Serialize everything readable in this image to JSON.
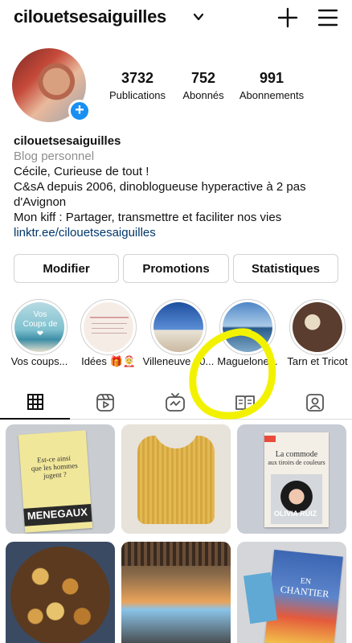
{
  "header": {
    "username": "cilouetsesaiguilles"
  },
  "stats": [
    {
      "value": "3732",
      "label": "Publications"
    },
    {
      "value": "752",
      "label": "Abonnés"
    },
    {
      "value": "991",
      "label": "Abonnements"
    }
  ],
  "bio": {
    "name": "cilouetsesaiguilles",
    "category": "Blog personnel",
    "lines": [
      "Cécile, Curieuse de tout !",
      "C&sA depuis 2006, dinoblogueuse hyperactive à 2 pas",
      "d'Avignon",
      "Mon kiff : Partager, transmettre et faciliter nos vies"
    ],
    "link": "linktr.ee/cilouetsesaiguilles"
  },
  "buttons": {
    "edit": "Modifier",
    "promotions": "Promotions",
    "insights": "Statistiques"
  },
  "highlights": [
    {
      "label": "Vos coups..."
    },
    {
      "label": "Idées 🎁🤶"
    },
    {
      "label": "Villeneuve 30..."
    },
    {
      "label": "Maguelone..."
    },
    {
      "label": "Tarn et Tricot"
    }
  ],
  "highlight_texts": {
    "first": "Vos Coups de ❤"
  },
  "tabs": [
    "posts-grid",
    "reels",
    "igtv",
    "guides",
    "tagged"
  ],
  "posts": [
    {
      "title_line1": "Est-ce ainsi",
      "title_line2": "que les hommes",
      "title_line3": "jugent ?",
      "author": "MENEGAUX"
    },
    {},
    {
      "title_line1": "La commode",
      "title_line2": "aux tiroirs de couleurs",
      "author": "OLIVIA RUIZ"
    },
    {},
    {},
    {
      "title_line1": "EN",
      "title_line2": "CHANTIER"
    }
  ],
  "colors": {
    "accent_blue": "#1a8ff2",
    "link_blue": "#00376b",
    "annotation_yellow": "#f2f200"
  }
}
